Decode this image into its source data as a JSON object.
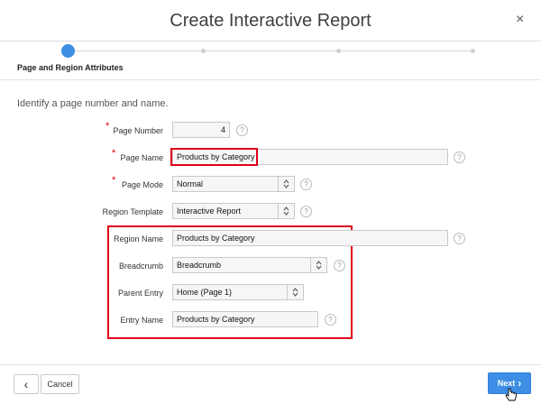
{
  "dialog": {
    "title": "Create Interactive Report",
    "close_glyph": "×"
  },
  "wizard": {
    "current_step_label": "Page and Region Attributes"
  },
  "intro_text": "Identify a page number and name.",
  "fields": {
    "page_number": {
      "label": "Page Number",
      "value": "4",
      "required": true
    },
    "page_name": {
      "label": "Page Name",
      "value": "Products by Category",
      "required": true
    },
    "page_mode": {
      "label": "Page Mode",
      "value": "Normal",
      "required": true
    },
    "region_template": {
      "label": "Region Template",
      "value": "Interactive Report"
    },
    "region_name": {
      "label": "Region Name",
      "value": "Products by Category"
    },
    "breadcrumb": {
      "label": "Breadcrumb",
      "value": "Breadcrumb"
    },
    "parent_entry": {
      "label": "Parent Entry",
      "value": "Home (Page 1)"
    },
    "entry_name": {
      "label": "Entry Name",
      "value": "Products by Category"
    }
  },
  "help_glyph": "?",
  "required_glyph": "*",
  "buttons": {
    "back_glyph": "‹",
    "cancel_label": "Cancel",
    "next_label": "Next",
    "next_glyph": "›"
  },
  "colors": {
    "accent": "#3d8ee4",
    "highlight_border": "#e0001a"
  }
}
